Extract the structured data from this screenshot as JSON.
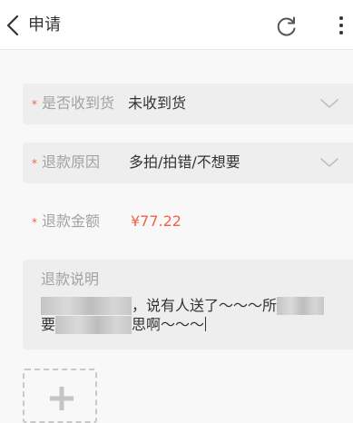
{
  "header": {
    "back_icon": "chevron-left-icon",
    "title": "申请",
    "refresh_icon": "refresh-icon",
    "more_icon": "more-vertical-icon"
  },
  "form": {
    "required_mark": "*",
    "received": {
      "label": "是否收到货",
      "value": "未收到货",
      "icon": "chevron-down-icon"
    },
    "reason": {
      "label": "退款原因",
      "value": "多拍/拍错/不想要",
      "icon": "chevron-down-icon"
    },
    "amount": {
      "label": "退款金额",
      "value": "¥77.22"
    },
    "description": {
      "label": "退款说明",
      "line1_text": "，说有人送了～～～所",
      "line2_prefix": "要",
      "line2_text": "思啊～～～"
    },
    "add_photo_icon": "plus-icon"
  },
  "colors": {
    "accent": "#f0624b",
    "field_bg": "#eeeeee",
    "label": "#a2a2a2",
    "text": "#333333",
    "page_bg": "#f8f8f8"
  }
}
